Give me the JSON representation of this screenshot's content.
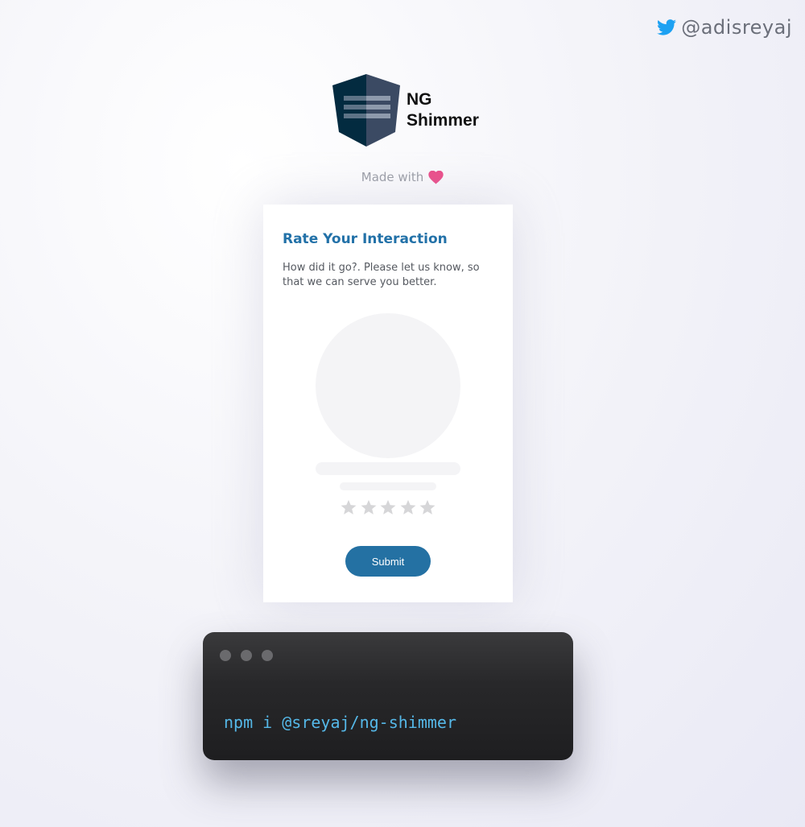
{
  "header": {
    "twitter_handle": "@adisreyaj",
    "twitter_icon": "twitter-bird-icon",
    "twitter_color": "#1da1f2"
  },
  "brand": {
    "name": "NG\nShimmer",
    "logo_icon": "ng-shimmer-shield-logo"
  },
  "made_with": {
    "label": "Made with",
    "icon": "heart-icon",
    "heart_color": "#ea4c89"
  },
  "card": {
    "title": "Rate Your Interaction",
    "description": "How did it go?. Please let us know, so that we can serve you better.",
    "rating": {
      "stars_total": 5,
      "stars_filled": 0
    },
    "submit_label": "Submit",
    "accent_color": "#2471a3"
  },
  "terminal": {
    "command": "npm i @sreyaj/ng-shimmer",
    "command_color": "#55b8e8"
  }
}
